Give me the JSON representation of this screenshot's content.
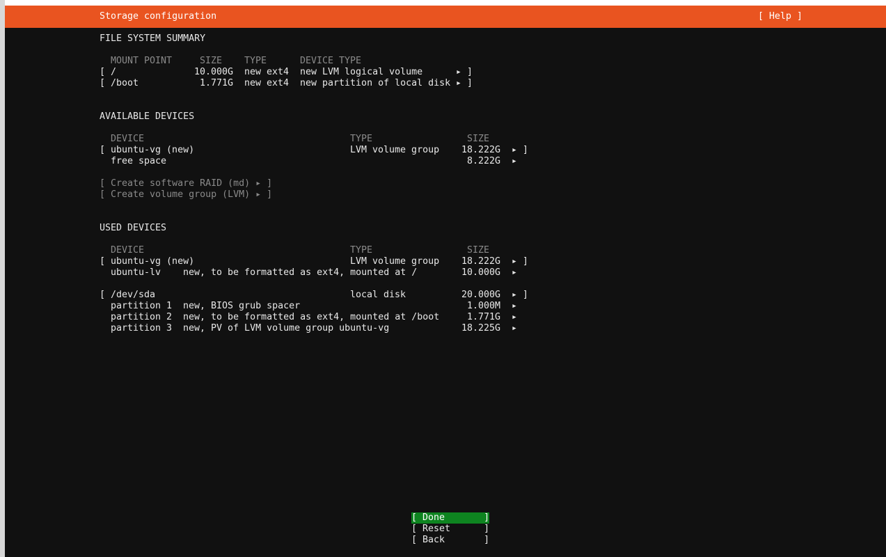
{
  "header": {
    "title": "Storage configuration",
    "help": "[ Help ]"
  },
  "fs_summary": {
    "heading": "FILE SYSTEM SUMMARY",
    "columns": [
      "MOUNT POINT",
      "SIZE",
      "TYPE",
      "DEVICE TYPE"
    ],
    "rows": [
      {
        "open": "[",
        "mount": "/",
        "size": "10.000G",
        "type": "new ext4",
        "device_type": "new LVM logical volume",
        "arrow": "▸ ]"
      },
      {
        "open": "[",
        "mount": "/boot",
        "size": "1.771G",
        "type": "new ext4",
        "device_type": "new partition of local disk",
        "arrow": "▸ ]"
      }
    ]
  },
  "available": {
    "heading": "AVAILABLE DEVICES",
    "columns": [
      "DEVICE",
      "TYPE",
      "SIZE"
    ],
    "rows": [
      {
        "open": "[",
        "device": "ubuntu-vg (new)",
        "type": "LVM volume group",
        "size": "18.222G",
        "arrow": "▸ ]"
      },
      {
        "open": "",
        "device": "free space",
        "type": "",
        "size": "8.222G",
        "arrow": "▸"
      }
    ],
    "actions": [
      "[ Create software RAID (md) ▸ ]",
      "[ Create volume group (LVM) ▸ ]"
    ]
  },
  "used": {
    "heading": "USED DEVICES",
    "columns": [
      "DEVICE",
      "TYPE",
      "SIZE"
    ],
    "groups": [
      {
        "open": "[",
        "device": "ubuntu-vg (new)",
        "type": "LVM volume group",
        "size": "18.222G",
        "arrow": "▸ ]",
        "children": [
          {
            "name": "ubuntu-lv",
            "desc": "new, to be formatted as ext4, mounted at /",
            "size": "10.000G",
            "arrow": "▸"
          }
        ]
      },
      {
        "open": "[",
        "device": "/dev/sda",
        "type": "local disk",
        "size": "20.000G",
        "arrow": "▸ ]",
        "children": [
          {
            "name": "partition 1",
            "desc": "new, BIOS grub spacer",
            "size": "1.000M",
            "arrow": "▸"
          },
          {
            "name": "partition 2",
            "desc": "new, to be formatted as ext4, mounted at /boot",
            "size": "1.771G",
            "arrow": "▸"
          },
          {
            "name": "partition 3",
            "desc": "new, PV of LVM volume group ubuntu-vg",
            "size": "18.225G",
            "arrow": "▸"
          }
        ]
      }
    ]
  },
  "buttons": {
    "done": "[ Done       ]",
    "reset": "[ Reset      ]",
    "back": "[ Back       ]"
  },
  "colors": {
    "header_bg": "#e95420",
    "done_bg": "#0e8420",
    "terminal_bg": "#111111"
  }
}
